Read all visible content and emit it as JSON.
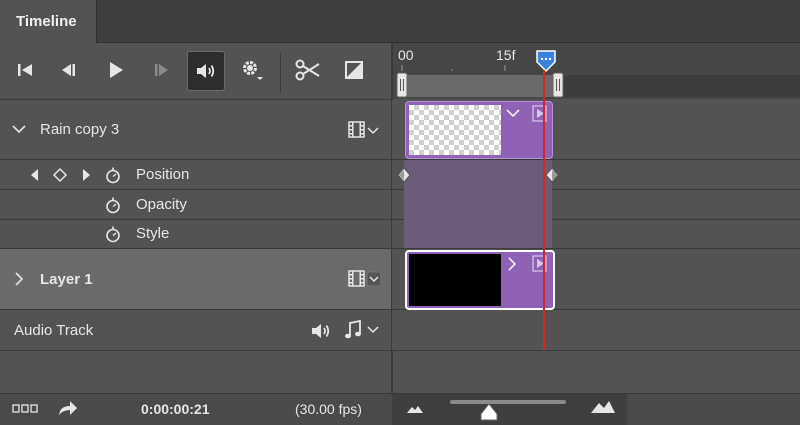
{
  "tab": {
    "label": "Timeline"
  },
  "ruler": {
    "start_label": "00",
    "mark_label": "15f"
  },
  "layers": [
    {
      "name": "Rain copy 3",
      "properties": [
        "Position",
        "Opacity",
        "Style"
      ]
    },
    {
      "name": "Layer 1"
    }
  ],
  "audio": {
    "label": "Audio Track"
  },
  "footer": {
    "timecode": "0:00:00:21",
    "fps": "(30.00 fps)"
  },
  "colors": {
    "clip": "#8e63b5",
    "playhead": "#d62525",
    "accent": "#3a82e0"
  },
  "icons": [
    "go-to-first-frame-icon",
    "prev-frame-icon",
    "play-icon",
    "next-frame-icon",
    "audio-icon",
    "gear-icon",
    "scissors-icon",
    "transition-icon",
    "film-icon",
    "chevron-down-icon",
    "chevron-right-icon",
    "keyframe-icon",
    "stopwatch-icon",
    "music-note-icon",
    "zoom-in-mountain-icon",
    "zoom-out-mountain-icon",
    "render-icon"
  ]
}
